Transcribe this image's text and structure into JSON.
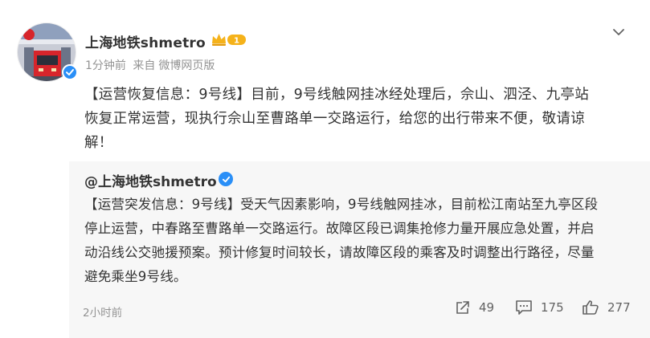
{
  "post": {
    "author": "上海地铁shmetro",
    "vip_level": "1",
    "time": "1分钟前",
    "source_prefix": "来自",
    "source": "微博网页版",
    "text_lines": [
      "【运营恢复信息：9号线】目前，9号线触网挂冰经处理后，佘山、泗泾、九亭站",
      "恢复正常运营，现执行佘山至曹路单一交路运行，给您的出行带来不便，敬请谅",
      "解！"
    ]
  },
  "retweet": {
    "author": "@上海地铁shmetro",
    "text_lines": [
      "【运营突发信息：9号线】受天气因素影响，9号线触网挂冰，目前松江南站至九亭区段",
      "停止运营，中春路至曹路单一交路运行。故障区段已调集抢修力量开展应急处置，并启",
      "动沿线公交驰援预案。预计修复时间较长，请故障区段的乘客及时调整出行路径，尽量",
      "避免乘坐9号线。"
    ],
    "time": "2小时前",
    "reposts": "49",
    "comments": "175",
    "likes": "277"
  },
  "colors": {
    "accent_blue": "#2a8ff7",
    "vip_gold": "#f5b21a",
    "metro_red": "#d7252b"
  }
}
